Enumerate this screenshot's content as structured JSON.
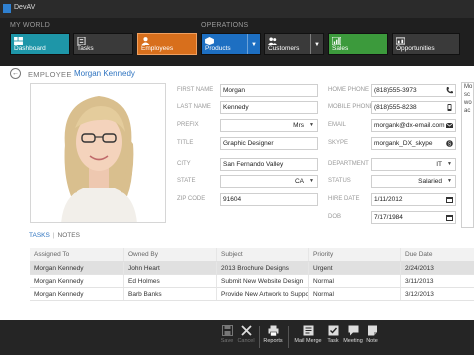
{
  "app": {
    "title": "DevAV"
  },
  "ribbon": {
    "groups": [
      "MY WORLD",
      "OPERATIONS"
    ],
    "tiles": [
      {
        "label": "Dashboard",
        "color": "#1e96a8"
      },
      {
        "label": "Tasks",
        "color": "#3a3a3a"
      },
      {
        "label": "Employees",
        "color": "#d86f1c"
      },
      {
        "label": "Products",
        "color": "#1d6fc2"
      },
      {
        "label": "Customers",
        "color": "#3a3a3a"
      },
      {
        "label": "Sales",
        "color": "#3c9a3c"
      },
      {
        "label": "Opportunities",
        "color": "#3a3a3a"
      }
    ]
  },
  "employee": {
    "caption": "EMPLOYEE",
    "name": "Morgan Kennedy",
    "fields": {
      "first_name": {
        "label": "FIRST NAME",
        "value": "Morgan"
      },
      "last_name": {
        "label": "LAST NAME",
        "value": "Kennedy"
      },
      "prefix": {
        "label": "PREFIX",
        "value": "Mrs"
      },
      "title": {
        "label": "TITLE",
        "value": "Graphic Designer"
      },
      "city": {
        "label": "CITY",
        "value": "San Fernando Valley"
      },
      "state": {
        "label": "STATE",
        "value": "CA"
      },
      "zip": {
        "label": "ZIP CODE",
        "value": "91604"
      },
      "home_phone": {
        "label": "HOME PHONE",
        "value": "(818)555-3973"
      },
      "mobile_phone": {
        "label": "MOBILE PHONE",
        "value": "(818)555-8238"
      },
      "email": {
        "label": "EMAIL",
        "value": "morgank@dx-email.com"
      },
      "skype": {
        "label": "SKYPE",
        "value": "morgank_DX_skype"
      },
      "department": {
        "label": "DEPARTMENT",
        "value": "IT"
      },
      "status": {
        "label": "STATUS",
        "value": "Salaried"
      },
      "hire_date": {
        "label": "HIRE DATE",
        "value": "1/11/2012"
      },
      "dob": {
        "label": "DOB",
        "value": "7/17/1984"
      }
    },
    "notes_snippet": "Mo\nsc\nwo\nac"
  },
  "tabs": {
    "tasks": "TASKS",
    "notes": "NOTES"
  },
  "grid": {
    "columns": [
      "Assigned To",
      "Owned By",
      "Subject",
      "Priority",
      "Due Date"
    ],
    "rows": [
      [
        "Morgan Kennedy",
        "John Heart",
        "2013 Brochure Designs",
        "Urgent",
        "2/24/2013"
      ],
      [
        "Morgan Kennedy",
        "Ed Holmes",
        "Submit New Website Design",
        "Normal",
        "3/11/2013"
      ],
      [
        "Morgan Kennedy",
        "Barb Banks",
        "Provide New Artwork to Support...",
        "Normal",
        "3/12/2013"
      ]
    ]
  },
  "bottombar": {
    "buttons": [
      {
        "label": "Save",
        "disabled": true
      },
      {
        "label": "Cancel",
        "disabled": true
      },
      {
        "label": "Reports",
        "disabled": false
      },
      {
        "label": "Mail Merge",
        "disabled": false
      },
      {
        "label": "Task",
        "disabled": false
      },
      {
        "label": "Meeting",
        "disabled": false
      },
      {
        "label": "Note",
        "disabled": false
      }
    ]
  }
}
